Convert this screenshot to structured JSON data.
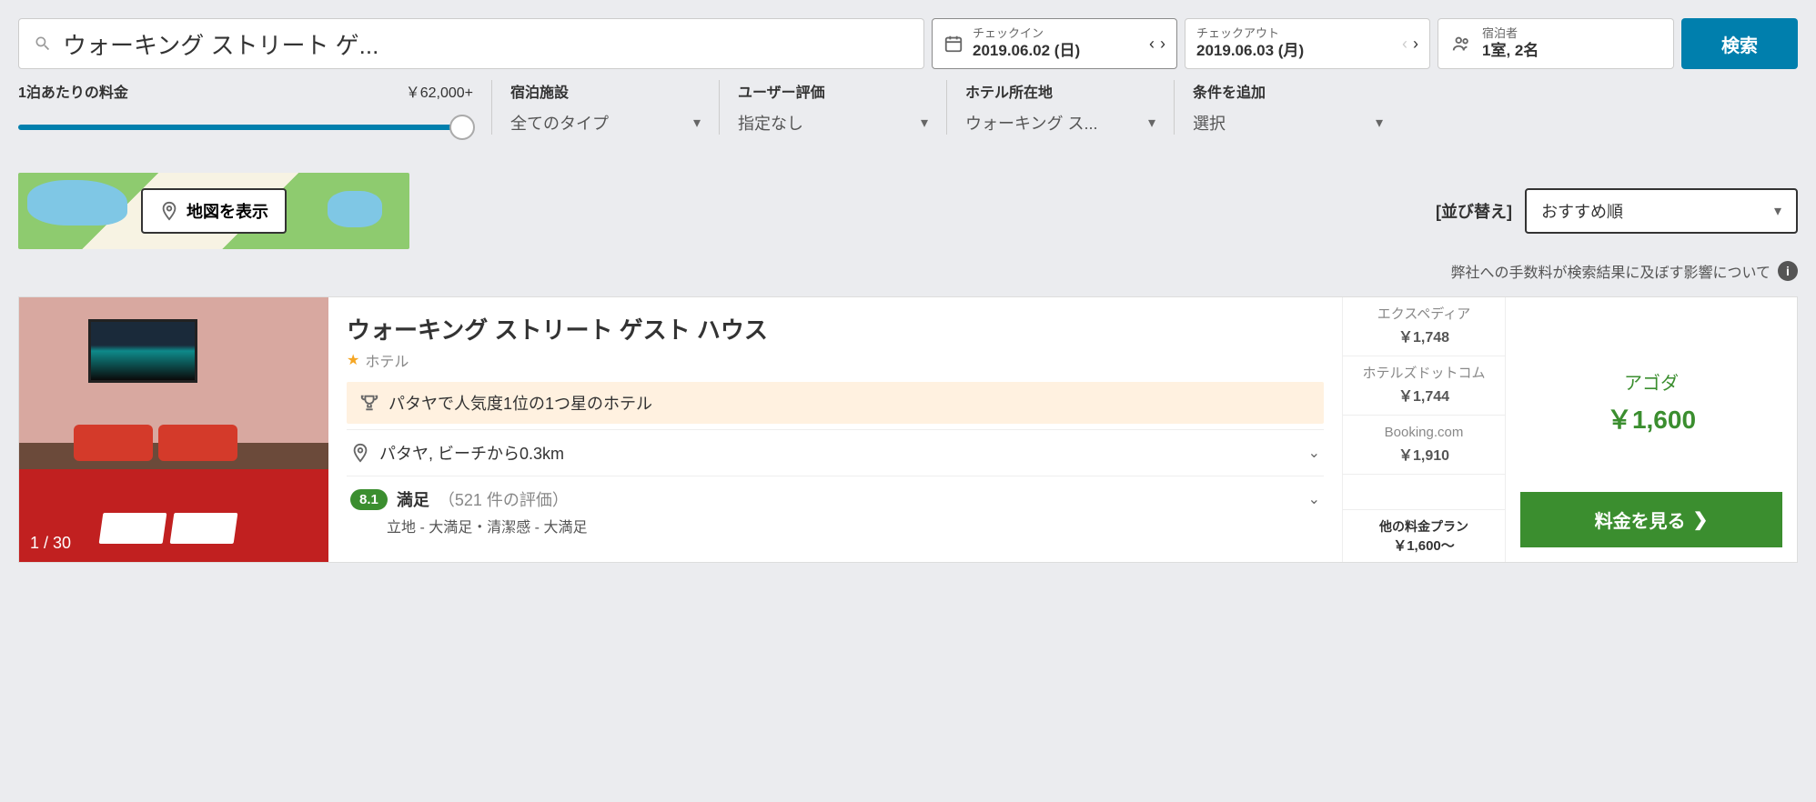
{
  "search": {
    "query": "ウォーキング ストリート ゲ...",
    "checkin_label": "チェックイン",
    "checkin_value": "2019.06.02 (日)",
    "checkout_label": "チェックアウト",
    "checkout_value": "2019.06.03 (月)",
    "guests_label": "宿泊者",
    "guests_value": "1室, 2名",
    "button": "検索"
  },
  "filters": {
    "price_label": "1泊あたりの料金",
    "price_max": "￥62,000+",
    "type_label": "宿泊施設",
    "type_value": "全てのタイプ",
    "rating_label": "ユーザー評価",
    "rating_value": "指定なし",
    "location_label": "ホテル所在地",
    "location_value": "ウォーキング ス...",
    "more_label": "条件を追加",
    "more_value": "選択"
  },
  "map_button": "地図を表示",
  "sort": {
    "label": "[並び替え]",
    "value": "おすすめ順"
  },
  "fee_note": "弊社への手数料が検索結果に及ぼす影響について",
  "hotel": {
    "name": "ウォーキング ストリート ゲスト ハウス",
    "type": "ホテル",
    "award": "パタヤで人気度1位の1つ星のホテル",
    "location": "パタヤ, ビーチから0.3km",
    "rating_score": "8.1",
    "rating_word": "満足",
    "rating_count": "（521 件の評価）",
    "rating_detail": "立地 - 大満足・清潔感 - 大満足",
    "photo_count": "1 / 30"
  },
  "deals": [
    {
      "name": "エクスペディア",
      "price": "￥1,748"
    },
    {
      "name": "ホテルズドットコム",
      "price": "￥1,744"
    },
    {
      "name": "Booking.com",
      "price": "￥1,910"
    }
  ],
  "other_plans": {
    "label": "他の料金プラン",
    "price": "￥1,600～"
  },
  "best": {
    "name": "アゴダ",
    "price": "￥1,600",
    "button": "料金を見る"
  }
}
